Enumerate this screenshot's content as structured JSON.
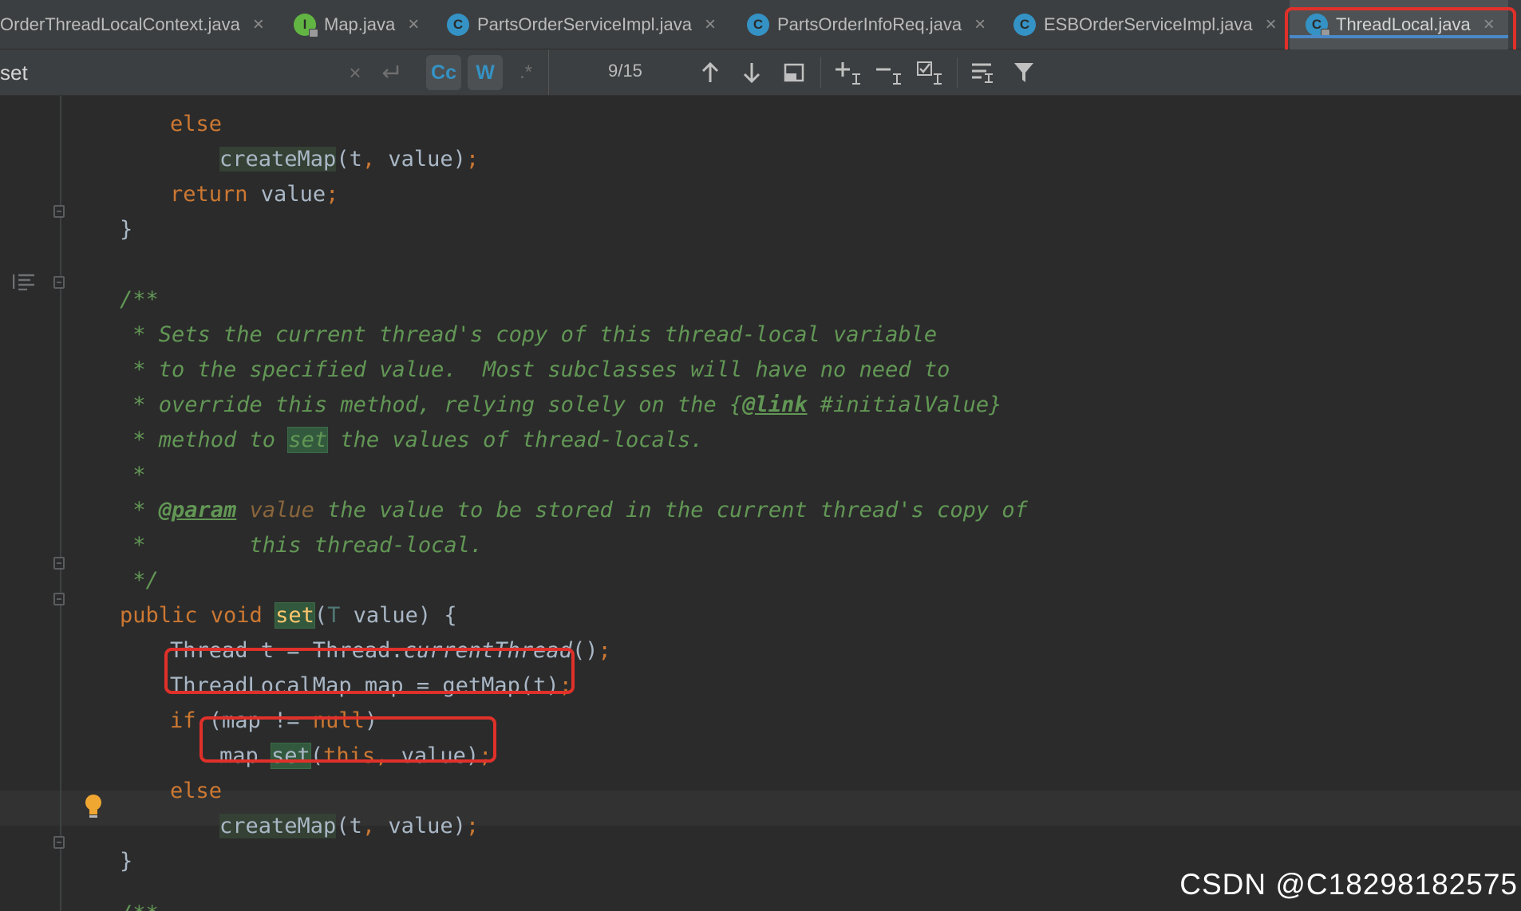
{
  "tabs": [
    {
      "label": "OrderThreadLocalContext.java",
      "icon": "class-file-icon",
      "active": false
    },
    {
      "label": "Map.java",
      "icon": "interface-file-icon",
      "active": false
    },
    {
      "label": "PartsOrderServiceImpl.java",
      "icon": "class-file-icon",
      "active": false
    },
    {
      "label": "PartsOrderInfoReq.java",
      "icon": "class-file-icon",
      "active": false
    },
    {
      "label": "ESBOrderServiceImpl.java",
      "icon": "class-file-icon",
      "active": false
    },
    {
      "label": "ThreadLocal.java",
      "icon": "class-file-icon",
      "active": true
    }
  ],
  "tab_icon_letters": {
    "class": "C",
    "iface": "I"
  },
  "search": {
    "query": "set",
    "match_case_label": "Cc",
    "whole_words_label": "W",
    "regex_label": ".*",
    "counter": "9/15"
  },
  "code": {
    "l1_else": "else",
    "l2_call": "createMap",
    "l2_args": "(t",
    "l2_comma": ",",
    "l2_rest": " value)",
    "l2_semi": ";",
    "l3_return": "return",
    "l3_rest": " value",
    "l3_semi": ";",
    "l4_brace": "}",
    "l6": "/**",
    "l7": " * Sets the current thread's copy of this thread-local variable",
    "l8": " * to the specified value.  Most subclasses will have no need to",
    "l9_a": " * override this method, relying solely on the {",
    "l9_tag": "@link",
    "l9_b": " #initialValue}",
    "l10_a": " * method to ",
    "l10_hl": "set",
    "l10_b": " the values of thread-locals.",
    "l11": " *",
    "l12_a": " * ",
    "l12_tag": "@param",
    "l12_param": " value",
    "l12_b": " the value to be stored in the current thread's copy of",
    "l13": " *        this thread-local.",
    "l14": " */",
    "l15_mods": "public void ",
    "l15_name": "set",
    "l15_open": "(",
    "l15_type": "T",
    "l15_rest": " value) {",
    "l16_a": "Thread t = Thread.",
    "l16_it": "currentThread",
    "l16_b": "()",
    "l16_semi": ";",
    "l17_a": "ThreadLocalMap map = getMap(t)",
    "l17_semi": ";",
    "l18_if": "if",
    "l18_a": " (map != ",
    "l18_null": "null",
    "l18_b": ")",
    "l19_a": "map.",
    "l19_hl": "set",
    "l19_b": "(",
    "l19_this": "this",
    "l19_comma": ",",
    "l19_c": " value)",
    "l19_semi": ";",
    "l20_else": "else",
    "l21_call": "createMap",
    "l21_args": "(t",
    "l21_comma": ",",
    "l21_rest": " value)",
    "l21_semi": ";",
    "l22_brace": "}",
    "l24": "/**"
  },
  "watermark": "CSDN @C18298182575",
  "colors": {
    "accent_tab_underline": "#4a88c7",
    "annotation_red": "#e0302a",
    "keyword": "#cc7832",
    "comment": "#629755",
    "function": "#ffc66d",
    "search_highlight": "#32593d"
  }
}
